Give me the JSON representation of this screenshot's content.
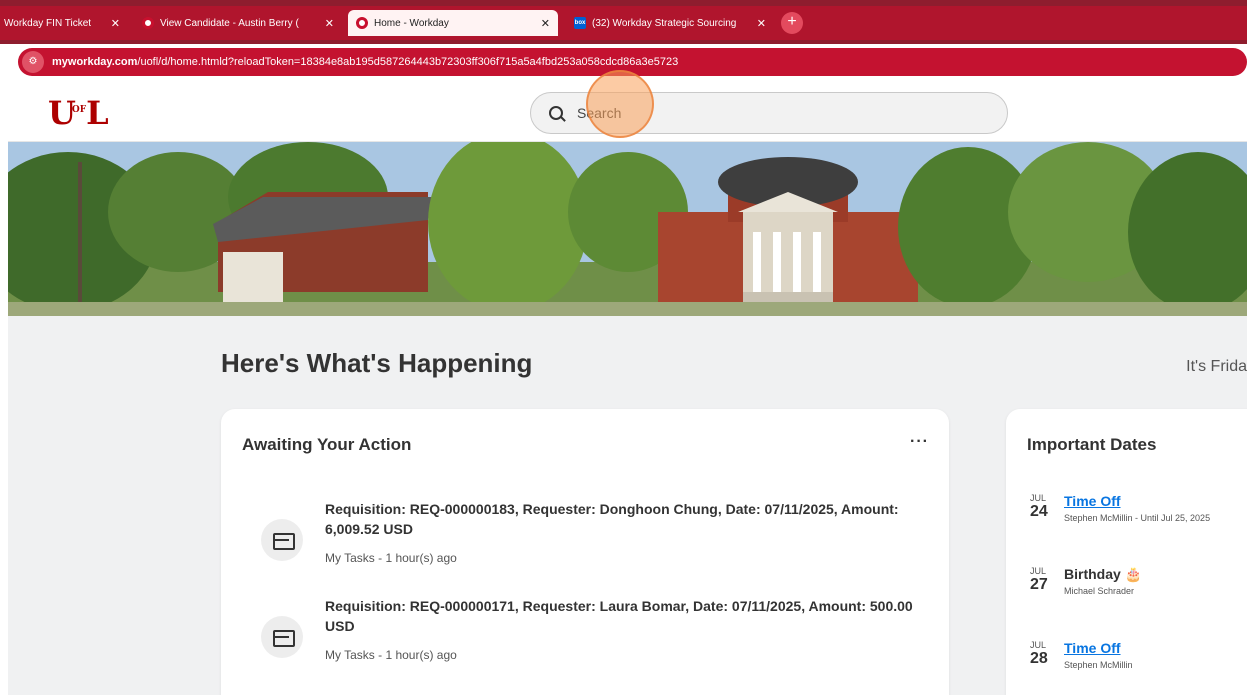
{
  "browser": {
    "tabs": [
      {
        "label": "Workday FIN Ticket",
        "close": "✕"
      },
      {
        "label": "View Candidate - Austin Berry (",
        "close": "✕"
      },
      {
        "label": "Home - Workday",
        "close": "✕"
      },
      {
        "label": "(32) Workday Strategic Sourcing",
        "close": "✕"
      }
    ],
    "new_tab": "+",
    "url_domain": "myworkday.com",
    "url_path": "/uofl/d/home.htmld?reloadToken=18384e8ab195d587264443b72303ff306f715a5a4fbd253a058cdcd86a3e5723"
  },
  "header": {
    "logo": "UL",
    "logo_small": "OF",
    "search_placeholder": "Search"
  },
  "main": {
    "heading": "Here's What's Happening",
    "greeting": "It's Frida"
  },
  "awaiting": {
    "title": "Awaiting Your Action",
    "more": "···",
    "tasks": [
      {
        "title": "Requisition: REQ-000000183, Requester: Donghoon Chung, Date: 07/11/2025, Amount: 6,009.52 USD",
        "sub": "My Tasks - 1 hour(s) ago"
      },
      {
        "title": "Requisition: REQ-000000171, Requester: Laura Bomar, Date: 07/11/2025, Amount: 500.00 USD",
        "sub": "My Tasks - 1 hour(s) ago"
      }
    ]
  },
  "important_dates": {
    "title": "Important Dates",
    "items": [
      {
        "month": "JUL",
        "day": "24",
        "title": "Time Off",
        "sub": "Stephen McMillin - Until Jul 25, 2025"
      },
      {
        "month": "JUL",
        "day": "27",
        "title": "Birthday 🎂",
        "sub": "Michael Schrader"
      },
      {
        "month": "JUL",
        "day": "28",
        "title": "Time Off",
        "sub": "Stephen McMillin"
      }
    ]
  },
  "colors": {
    "brand_red": "#ad0000",
    "tab_bar": "#b0152d",
    "link": "#0875e1"
  }
}
